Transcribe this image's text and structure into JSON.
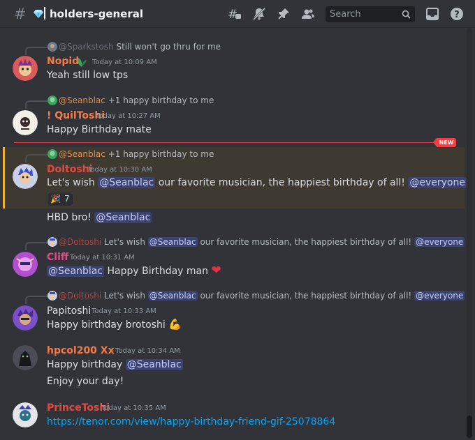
{
  "header": {
    "channel_name": "holders-general",
    "search_placeholder": "Search"
  },
  "new_badge": "NEW",
  "messages": [
    {
      "reply_name": "@Sparkstosh",
      "reply_text": "Still won't go thru for me",
      "username": "Nopid",
      "timestamp": "Today at 10:09 AM",
      "text": "Yeah still low tps"
    },
    {
      "reply_name": "@Seanblac",
      "reply_text": "+1 happy birthday to me",
      "username": "! QuilToshi",
      "timestamp": "Today at 10:27 AM",
      "text": "Happy Birthday mate"
    },
    {
      "reply_name": "@Seanblac",
      "reply_text": "+1 happy birthday to me",
      "username": "Doltoshi",
      "timestamp": "Today at 10:30 AM",
      "text_a": "Let's wish",
      "mention1": "@Seanblac",
      "text_b": "our favorite musician, the happiest birthday of all!",
      "mention2": "@everyone",
      "reaction_emoji": "🎉",
      "reaction_count": "7"
    },
    {
      "text_a": "HBD bro!",
      "mention": "@Seanblac"
    },
    {
      "reply_name": "@Doltoshi",
      "reply_text_a": "Let's wish",
      "reply_mention1": "@Seanblac",
      "reply_text_b": "our favorite musician, the happiest birthday of all!",
      "reply_mention2": "@everyone",
      "username": "Cliff",
      "timestamp": "Today at 10:31 AM",
      "mention": "@Seanblac",
      "text": "Happy Birthday man",
      "emoji": "❤"
    },
    {
      "reply_name": "@Doltoshi",
      "reply_text_a": "Let's wish",
      "reply_mention1": "@Seanblac",
      "reply_text_b": "our favorite musician, the happiest birthday of all!",
      "reply_mention2": "@everyone",
      "username": "Papitoshi",
      "timestamp": "Today at 10:33 AM",
      "text": "Happy birthday brotoshi",
      "emoji": "💪"
    },
    {
      "username": "hpcol200 Xx",
      "timestamp": "Today at 10:34 AM",
      "text_a": "Happy birthday",
      "mention": "@Seanblac",
      "text_line2": "Enjoy your day!"
    },
    {
      "username": "PrinceToshi",
      "timestamp": "Today at 10:35 AM",
      "link": "https://tenor.com/view/happy-birthday-friend-gif-25078864"
    }
  ],
  "colors": {
    "bg": "#313338",
    "mention_bg": "#3c4270",
    "mention_fg": "#c9cdfb",
    "new_red": "#f23f43",
    "link": "#00a8fc",
    "highlight": "#3e3a32",
    "highlight_border": "#f0b232"
  }
}
